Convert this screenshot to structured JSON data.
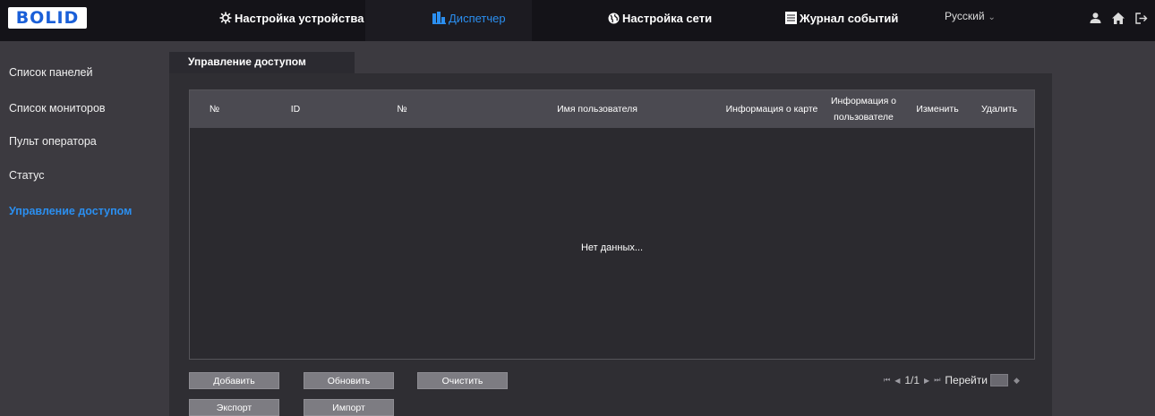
{
  "header": {
    "logo_text": "BOLID",
    "nav": [
      {
        "label": "Настройка устройства",
        "icon": "gear-cross-icon"
      },
      {
        "label": "Диспетчер",
        "icon": "buildings-icon",
        "active": true
      },
      {
        "label": "Настройка сети",
        "icon": "globe-icon"
      },
      {
        "label": "Журнал событий",
        "icon": "log-book-icon"
      }
    ],
    "language": "Русский",
    "right_icons": [
      "user-icon",
      "home-icon",
      "logout-icon"
    ]
  },
  "sidebar": {
    "items": [
      {
        "label": "Список панелей"
      },
      {
        "label": "Список мониторов"
      },
      {
        "label": "Пульт оператора"
      },
      {
        "label": "Статус"
      },
      {
        "label": "Управление доступом",
        "active": true
      }
    ]
  },
  "main": {
    "tab_label": "Управление доступом",
    "table": {
      "columns": [
        "№",
        "ID",
        "№",
        "Имя пользователя",
        "Информация о карте",
        "Информация о пользователе",
        "Изменить",
        "Удалить"
      ],
      "rows": [],
      "empty_text": "Нет данных..."
    },
    "buttons": {
      "add": "Добавить",
      "refresh": "Обновить",
      "clear": "Очистить",
      "export": "Экспорт",
      "import": "Импорт"
    },
    "pagination": {
      "page_text": "1/1",
      "goto_label": "Перейти"
    }
  },
  "colors": {
    "accent": "#2b8ff0",
    "topbar_bg": "#141318",
    "page_bg": "#3c3a40",
    "table_header_bg": "#4b4a51",
    "button_bg": "#7d7c82",
    "logo_blue": "#1a5fd8"
  }
}
